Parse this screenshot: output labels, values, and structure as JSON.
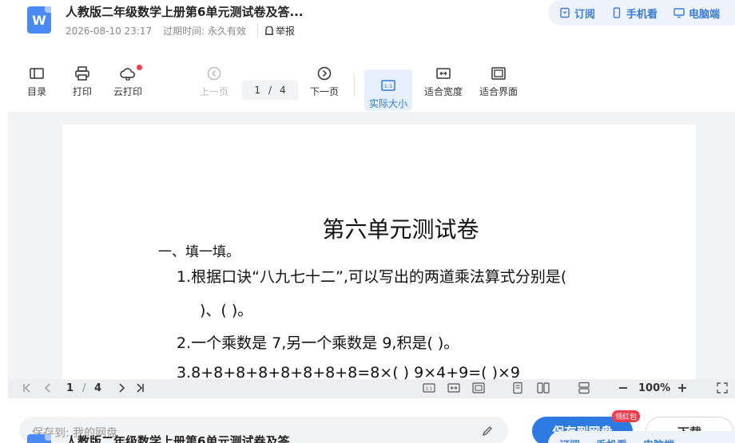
{
  "header": {
    "title": "人教版二年级数学上册第6单元测试卷及答...",
    "date": "2026-08-10 23:17",
    "expire_label": "过期时间:",
    "expire_value": "永久有效",
    "report": "举报",
    "actions": {
      "subscribe": "订阅",
      "mobile": "手机看",
      "pc": "电脑端"
    }
  },
  "toolbar": {
    "catalog": "目录",
    "print": "打印",
    "cloud_print": "云打印",
    "prev": "上一页",
    "page_current": "1",
    "page_sep": "/",
    "page_total": "4",
    "next": "下一页",
    "actual_size": "实际大小",
    "fit_width": "适合宽度",
    "fit_page": "适合界面"
  },
  "document": {
    "title": "第六单元测试卷",
    "section": "一、填一填。",
    "q1a": "1.根据口诀“八九七十二”,可以写出的两道乘法算式分别是(",
    "q1b": ")、(                    )。",
    "q2": "2.一个乘数是 7,另一个乘数是 9,积是(       )。",
    "q3": "3.8+8+8+8+8+8+8+8=8×(       )   9×4+9=(       )×9"
  },
  "statusbar": {
    "page_current": "1",
    "page_sep": "/",
    "page_total": "4",
    "zoom": "100%"
  },
  "bottom": {
    "save_placeholder": "保存到:  我的网盘",
    "save_button": "保存到网盘",
    "hongbao": "领红包",
    "download": "下载"
  },
  "colors": {
    "accent": "#2d7ae0",
    "red": "#f03e4f",
    "viewer_bg": "#f2f3f5"
  }
}
